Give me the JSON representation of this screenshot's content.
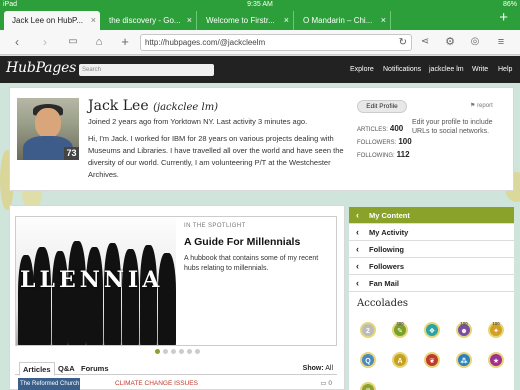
{
  "status_bar": {
    "device": "iPad",
    "time": "9:35 AM",
    "battery": "86%"
  },
  "tabs": [
    {
      "label": "Jack Lee on HubP..."
    },
    {
      "label": "the discovery - Go..."
    },
    {
      "label": "Welcome to Firstr..."
    },
    {
      "label": "O Mandarin – Chi..."
    }
  ],
  "toolbar": {
    "url": "http://hubpages.com/@jackcleelm"
  },
  "site": {
    "logo": "HubPages",
    "search_placeholder": "Search",
    "nav": [
      "Explore",
      "Notifications",
      "jackclee lm",
      "Write",
      "Help"
    ]
  },
  "profile": {
    "name": "Jack Lee",
    "handle": "(jackclee lm)",
    "score": "73",
    "joined": "Joined 2 years ago from Yorktown NY. Last activity 3 minutes ago.",
    "bio": "Hi, I'm Jack. I worked for IBM for 28 years on various projects dealing with Museums and Libraries. I have travelled all over the world and have seen the diversity of our world. Currently, I am volunteering P/T at the Westchester Archives.",
    "edit_button": "Edit Profile",
    "report": "report",
    "edit_info": "Edit your profile to include URLs to social networks.",
    "stats": [
      {
        "label": "ARTICLES:",
        "value": "400"
      },
      {
        "label": "FOLLOWERS:",
        "value": "100"
      },
      {
        "label": "FOLLOWING:",
        "value": "112"
      }
    ]
  },
  "spotlight": {
    "label": "IN THE SPOTLIGHT",
    "title": "A Guide For Millennials",
    "description": "A hubbook that contains some of my recent hubs relating to millennials.",
    "image_text": "LLENNIA"
  },
  "content_tabs": {
    "items": [
      "Articles",
      "Q&A",
      "Forums"
    ],
    "show_label": "Show:",
    "show_value": "All"
  },
  "article_preview": {
    "title": "The Reformed Church of ...",
    "category": "CLIMATE CHANGE ISSUES",
    "comments": "0"
  },
  "sidebar": {
    "items": [
      "My Content",
      "My Activity",
      "Following",
      "Followers",
      "Fan Mail"
    ]
  },
  "accolades": {
    "title": "Accolades",
    "badges": [
      {
        "num": "",
        "glyph": "2",
        "color": "#bbbbbb"
      },
      {
        "num": "300",
        "glyph": "✎",
        "color": "#7aa02a"
      },
      {
        "num": "",
        "glyph": "❖",
        "color": "#2aa3a3"
      },
      {
        "num": "100",
        "glyph": "☻",
        "color": "#7a4fa0"
      },
      {
        "num": "100",
        "glyph": "✦",
        "color": "#d4a020"
      },
      {
        "num": "",
        "glyph": "Q",
        "color": "#4a8abf"
      },
      {
        "num": "",
        "glyph": "A",
        "color": "#c6a020"
      },
      {
        "num": "",
        "glyph": "❦",
        "color": "#c0392b"
      },
      {
        "num": "",
        "glyph": "⁂",
        "color": "#2a7fbf"
      },
      {
        "num": "",
        "glyph": "★",
        "color": "#a03090"
      },
      {
        "num": "",
        "glyph": "♛",
        "color": "#8aa12a"
      }
    ]
  },
  "colors": {
    "accent": "#8aa12a",
    "browser_chrome": "#2c9e3a",
    "header": "#222222"
  }
}
